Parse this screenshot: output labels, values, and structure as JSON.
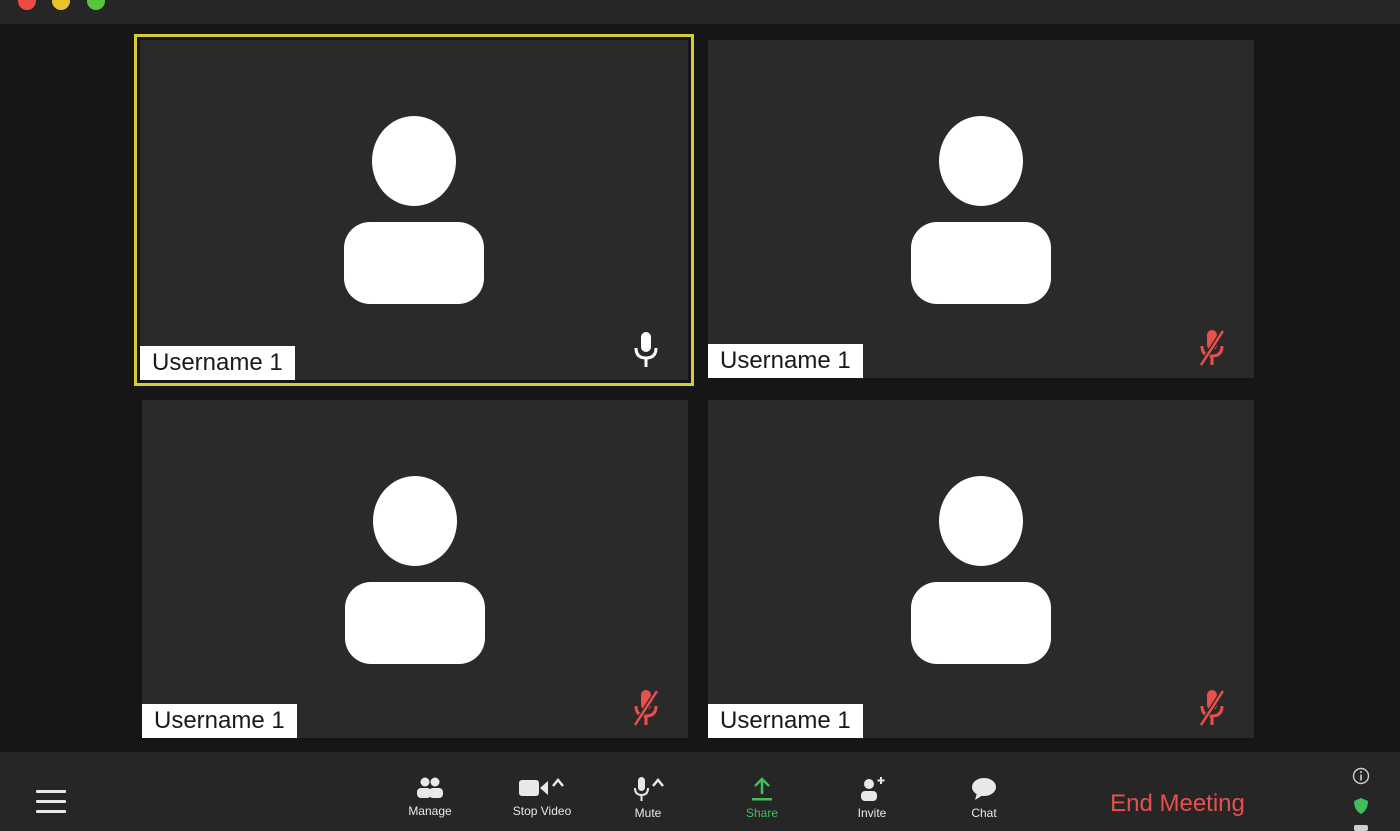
{
  "window": {
    "controls": [
      "close",
      "minimize",
      "maximize"
    ]
  },
  "participants": [
    {
      "name": "Username 1",
      "speaking": true,
      "mic": "on"
    },
    {
      "name": "Username 1",
      "speaking": false,
      "mic": "muted"
    },
    {
      "name": "Username 1",
      "speaking": false,
      "mic": "muted"
    },
    {
      "name": "Username 1",
      "speaking": false,
      "mic": "muted"
    }
  ],
  "toolbar": {
    "manage_participants_label": "Manage",
    "stop_video_label": "Stop Video",
    "mute_label": "Mute",
    "share_label": "Share",
    "invite_label": "Invite",
    "chat_label": "Chat",
    "end_meeting_label": "End Meeting"
  },
  "colors": {
    "speaking_border": "#d6cc3a",
    "muted_mic": "#e8504e",
    "share_accent": "#3fbf5a",
    "end_meeting": "#e8504e",
    "tile_background": "#2a2a2a",
    "window_background": "#161616"
  },
  "icons": {
    "menu": "hamburger-menu-icon",
    "info": "info-icon",
    "encryption": "shield-icon"
  }
}
